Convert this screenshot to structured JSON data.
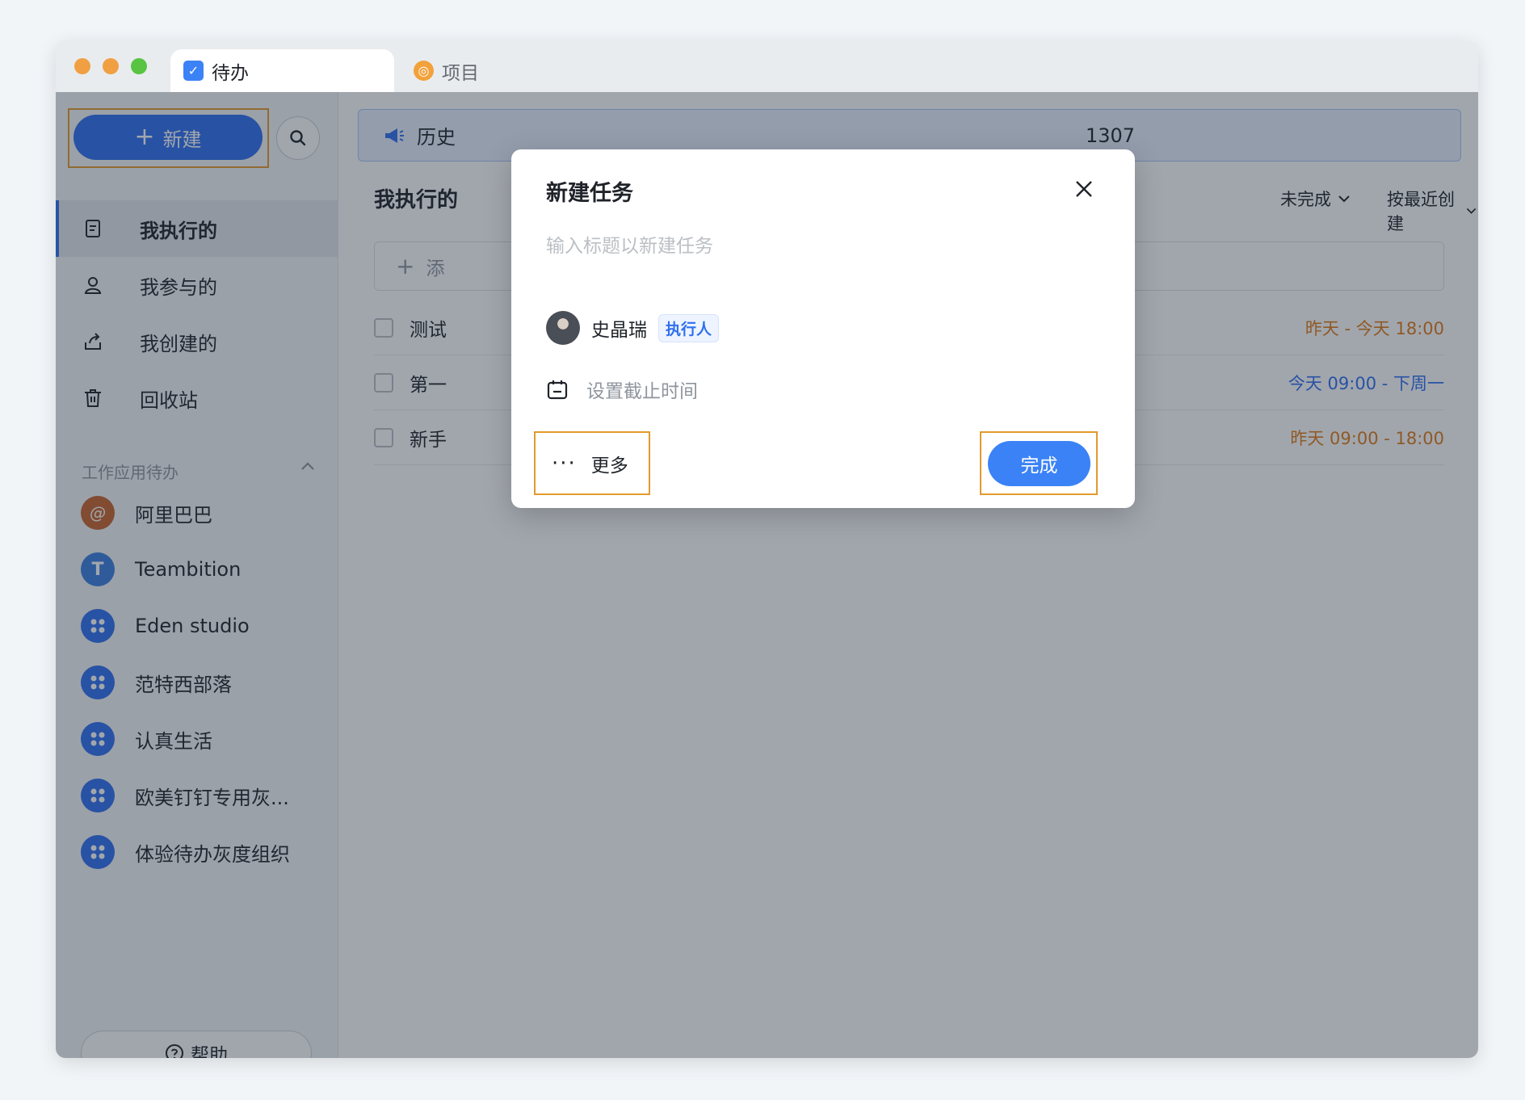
{
  "window": {
    "traffic_colors": [
      "#f0a042",
      "#f0a042",
      "#58c442"
    ],
    "tabs": [
      {
        "label": "待办",
        "active": true,
        "icon": "checkbox-icon",
        "color": "#3b82f6"
      },
      {
        "label": "项目",
        "active": false,
        "icon": "project-icon",
        "color": "#f2a13b"
      }
    ]
  },
  "sidebar": {
    "new_label": "新建",
    "nav": [
      {
        "label": "我执行的",
        "icon": "assigned-icon",
        "active": true
      },
      {
        "label": "我参与的",
        "icon": "participant-icon",
        "active": false
      },
      {
        "label": "我创建的",
        "icon": "created-icon",
        "active": false
      },
      {
        "label": "回收站",
        "icon": "trash-icon",
        "active": false
      }
    ],
    "group_title": "工作应用待办",
    "apps": [
      {
        "label": "阿里巴巴",
        "icon": "alibaba-icon",
        "color": "#c8642c"
      },
      {
        "label": "Teambition",
        "icon": "teambition-icon",
        "color": "#3b7fe0"
      },
      {
        "label": "Eden studio",
        "icon": "app-grid-icon",
        "color": "#2f6ff0"
      },
      {
        "label": "范特西部落",
        "icon": "app-grid-icon",
        "color": "#2f6ff0"
      },
      {
        "label": "认真生活",
        "icon": "app-grid-icon",
        "color": "#2f6ff0"
      },
      {
        "label": "欧美钉钉专用灰...",
        "icon": "app-grid-icon",
        "color": "#2f6ff0"
      },
      {
        "label": "体验待办灰度组织",
        "icon": "app-grid-icon",
        "color": "#2f6ff0"
      }
    ],
    "help_label": "帮助"
  },
  "main": {
    "banner": {
      "left_text": "历史",
      "right_text": "1307"
    },
    "section_title": "我执行的",
    "filters": {
      "status": "未完成",
      "sort": "按最近创建"
    },
    "add_placeholder": "添",
    "tasks": [
      {
        "title": "测试",
        "time": "昨天 - 今天 18:00",
        "time_color": "#e07b16"
      },
      {
        "title": "第一",
        "time": "今天 09:00 - 下周一",
        "time_color": "#2f6ff0"
      },
      {
        "title": "新手",
        "time": "昨天 09:00 - 18:00",
        "time_color": "#e07b16"
      }
    ]
  },
  "modal": {
    "title": "新建任务",
    "input_placeholder": "输入标题以新建任务",
    "assignee_name": "史晶瑞",
    "assignee_role": "执行人",
    "due_placeholder": "设置截止时间",
    "more_label": "更多",
    "done_label": "完成"
  }
}
